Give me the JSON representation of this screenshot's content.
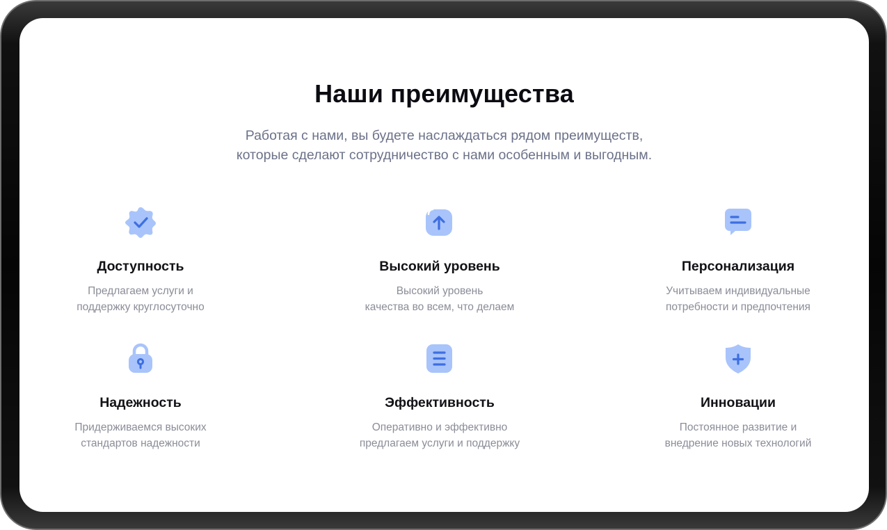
{
  "header": {
    "title": "Наши преимущества",
    "subtitle_line1": "Работая с нами, вы будете наслаждаться рядом преимуществ,",
    "subtitle_line2": "которые сделают сотрудничество с нами особенным и выгодным."
  },
  "features": [
    {
      "icon": "verified-badge-icon",
      "title": "Доступность",
      "desc_line1": "Предлагаем услуги и",
      "desc_line2": "поддержку круглосуточно"
    },
    {
      "icon": "arrow-up-icon",
      "title": "Высокий уровень",
      "desc_line1": "Высокий уровень",
      "desc_line2": "качества во всем, что делаем"
    },
    {
      "icon": "chat-bubble-icon",
      "title": "Персонализация",
      "desc_line1": "Учитываем индивидуальные",
      "desc_line2": "потребности и предпочтения"
    },
    {
      "icon": "lock-icon",
      "title": "Надежность",
      "desc_line1": "Придерживаемся высоких",
      "desc_line2": "стандартов надежности"
    },
    {
      "icon": "document-list-icon",
      "title": "Эффективность",
      "desc_line1": "Оперативно и эффективно",
      "desc_line2": "предлагаем услуги и поддержку"
    },
    {
      "icon": "shield-plus-icon",
      "title": "Инновации",
      "desc_line1": "Постоянное развитие и",
      "desc_line2": "внедрение новых технологий"
    }
  ],
  "colors": {
    "icon_light": "#a9c4fb",
    "icon_dark": "#3d6fe0",
    "title": "#0b0b12",
    "subtitle": "#6b7189",
    "description": "#8b8d98"
  }
}
